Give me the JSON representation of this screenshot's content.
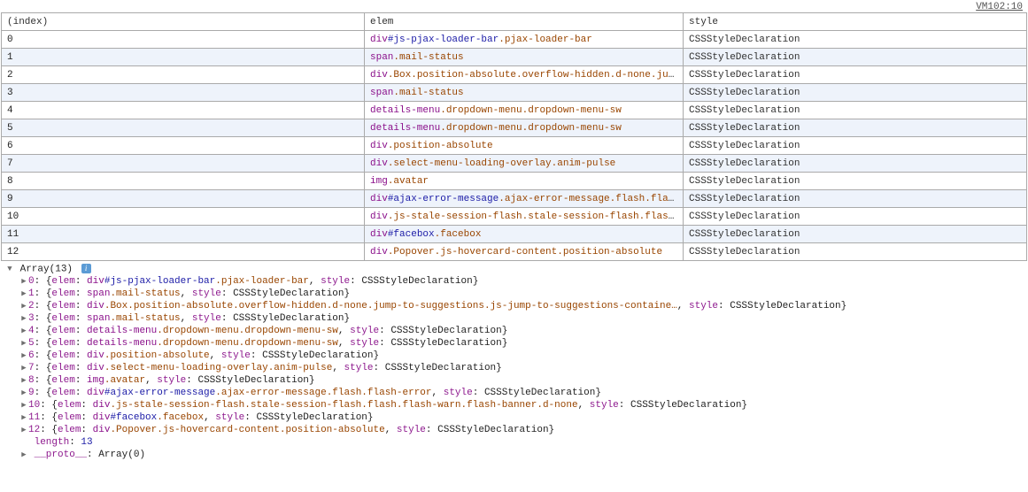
{
  "source": {
    "label": "VM102:10"
  },
  "table": {
    "headers": [
      "(index)",
      "elem",
      "style"
    ],
    "rows": [
      {
        "index": "0",
        "elem": {
          "tag": "div",
          "id": "js-pjax-loader-bar",
          "classes": [
            "pjax-loader-bar"
          ]
        },
        "style": "CSSStyleDeclaration"
      },
      {
        "index": "1",
        "elem": {
          "tag": "span",
          "id": null,
          "classes": [
            "mail-status"
          ]
        },
        "style": "CSSStyleDeclaration"
      },
      {
        "index": "2",
        "elem": {
          "tag": "div",
          "id": null,
          "classes": [
            "Box",
            "position-absolute",
            "overflow-hidden",
            "d-none",
            "jump-t"
          ],
          "truncated": true
        },
        "style": "CSSStyleDeclaration"
      },
      {
        "index": "3",
        "elem": {
          "tag": "span",
          "id": null,
          "classes": [
            "mail-status"
          ]
        },
        "style": "CSSStyleDeclaration"
      },
      {
        "index": "4",
        "elem": {
          "tag": "details-menu",
          "id": null,
          "classes": [
            "dropdown-menu",
            "dropdown-menu-sw"
          ]
        },
        "style": "CSSStyleDeclaration"
      },
      {
        "index": "5",
        "elem": {
          "tag": "details-menu",
          "id": null,
          "classes": [
            "dropdown-menu",
            "dropdown-menu-sw"
          ]
        },
        "style": "CSSStyleDeclaration"
      },
      {
        "index": "6",
        "elem": {
          "tag": "div",
          "id": null,
          "classes": [
            "position-absolute"
          ]
        },
        "style": "CSSStyleDeclaration"
      },
      {
        "index": "7",
        "elem": {
          "tag": "div",
          "id": null,
          "classes": [
            "select-menu-loading-overlay",
            "anim-pulse"
          ]
        },
        "style": "CSSStyleDeclaration"
      },
      {
        "index": "8",
        "elem": {
          "tag": "img",
          "id": null,
          "classes": [
            "avatar"
          ]
        },
        "style": "CSSStyleDeclaration"
      },
      {
        "index": "9",
        "elem": {
          "tag": "div",
          "id": "ajax-error-message",
          "classes": [
            "ajax-error-message",
            "flash",
            "flash-e"
          ],
          "truncated": true
        },
        "style": "CSSStyleDeclaration"
      },
      {
        "index": "10",
        "elem": {
          "tag": "div",
          "id": null,
          "classes": [
            "js-stale-session-flash",
            "stale-session-flash",
            "flash",
            "fl"
          ],
          "truncated": true
        },
        "style": "CSSStyleDeclaration"
      },
      {
        "index": "11",
        "elem": {
          "tag": "div",
          "id": "facebox",
          "classes": [
            "facebox"
          ]
        },
        "style": "CSSStyleDeclaration"
      },
      {
        "index": "12",
        "elem": {
          "tag": "div",
          "id": null,
          "classes": [
            "Popover",
            "js-hovercard-content",
            "position-absolute"
          ]
        },
        "style": "CSSStyleDeclaration"
      }
    ]
  },
  "obj": {
    "root_label": "Array(13)",
    "entries": [
      {
        "idx": "0",
        "elem": {
          "tag": "div",
          "id": "js-pjax-loader-bar",
          "classes": [
            "pjax-loader-bar"
          ]
        },
        "style": "CSSStyleDeclaration"
      },
      {
        "idx": "1",
        "elem": {
          "tag": "span",
          "id": null,
          "classes": [
            "mail-status"
          ]
        },
        "style": "CSSStyleDeclaration"
      },
      {
        "idx": "2",
        "elem": {
          "tag": "div",
          "id": null,
          "classes": [
            "Box",
            "position-absolute",
            "overflow-hidden",
            "d-none",
            "jump-to-suggestions",
            "js-jump-to-suggestions-containe"
          ],
          "truncated": true
        },
        "style": "CSSStyleDeclaration"
      },
      {
        "idx": "3",
        "elem": {
          "tag": "span",
          "id": null,
          "classes": [
            "mail-status"
          ]
        },
        "style": "CSSStyleDeclaration"
      },
      {
        "idx": "4",
        "elem": {
          "tag": "details-menu",
          "id": null,
          "classes": [
            "dropdown-menu",
            "dropdown-menu-sw"
          ]
        },
        "style": "CSSStyleDeclaration"
      },
      {
        "idx": "5",
        "elem": {
          "tag": "details-menu",
          "id": null,
          "classes": [
            "dropdown-menu",
            "dropdown-menu-sw"
          ]
        },
        "style": "CSSStyleDeclaration"
      },
      {
        "idx": "6",
        "elem": {
          "tag": "div",
          "id": null,
          "classes": [
            "position-absolute"
          ]
        },
        "style": "CSSStyleDeclaration"
      },
      {
        "idx": "7",
        "elem": {
          "tag": "div",
          "id": null,
          "classes": [
            "select-menu-loading-overlay",
            "anim-pulse"
          ]
        },
        "style": "CSSStyleDeclaration"
      },
      {
        "idx": "8",
        "elem": {
          "tag": "img",
          "id": null,
          "classes": [
            "avatar"
          ]
        },
        "style": "CSSStyleDeclaration"
      },
      {
        "idx": "9",
        "elem": {
          "tag": "div",
          "id": "ajax-error-message",
          "classes": [
            "ajax-error-message",
            "flash",
            "flash-error"
          ]
        },
        "style": "CSSStyleDeclaration"
      },
      {
        "idx": "10",
        "elem": {
          "tag": "div",
          "id": null,
          "classes": [
            "js-stale-session-flash",
            "stale-session-flash",
            "flash",
            "flash-warn",
            "flash-banner",
            "d-none"
          ]
        },
        "style": "CSSStyleDeclaration"
      },
      {
        "idx": "11",
        "elem": {
          "tag": "div",
          "id": "facebox",
          "classes": [
            "facebox"
          ]
        },
        "style": "CSSStyleDeclaration"
      },
      {
        "idx": "12",
        "elem": {
          "tag": "div",
          "id": null,
          "classes": [
            "Popover",
            "js-hovercard-content",
            "position-absolute"
          ]
        },
        "style": "CSSStyleDeclaration"
      }
    ],
    "length_label": "length",
    "length_value": "13",
    "proto_label": "__proto__",
    "proto_value": "Array(0)",
    "keys": {
      "elem": "elem",
      "style": "style"
    }
  }
}
